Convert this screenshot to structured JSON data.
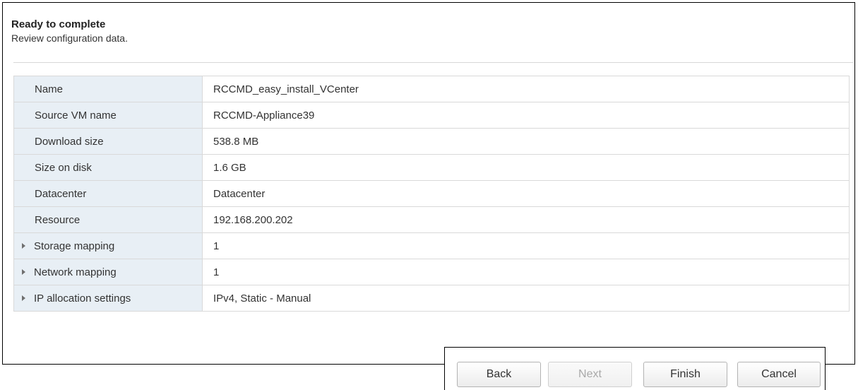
{
  "header": {
    "title": "Ready to complete",
    "subtitle": "Review configuration data."
  },
  "review_table": {
    "rows": [
      {
        "label": "Name",
        "value": "RCCMD_easy_install_VCenter",
        "expandable": false
      },
      {
        "label": "Source VM name",
        "value": "RCCMD-Appliance39",
        "expandable": false
      },
      {
        "label": "Download size",
        "value": "538.8 MB",
        "expandable": false
      },
      {
        "label": "Size on disk",
        "value": "1.6 GB",
        "expandable": false
      },
      {
        "label": "Datacenter",
        "value": "Datacenter",
        "expandable": false
      },
      {
        "label": "Resource",
        "value": "192.168.200.202",
        "expandable": false
      },
      {
        "label": "Storage mapping",
        "value": "1",
        "expandable": true,
        "icon": "chevron-right-icon"
      },
      {
        "label": "Network mapping",
        "value": "1",
        "expandable": true,
        "icon": "chevron-right-icon"
      },
      {
        "label": "IP allocation settings",
        "value": "IPv4, Static - Manual",
        "expandable": true,
        "icon": "chevron-right-icon"
      }
    ]
  },
  "footer": {
    "back_label": "Back",
    "next_label": "Next",
    "next_enabled": false,
    "finish_label": "Finish",
    "cancel_label": "Cancel"
  },
  "colors": {
    "label_background": "#e8eff5",
    "border": "#d9d9d9",
    "disabled_text": "#a9a9a9"
  }
}
